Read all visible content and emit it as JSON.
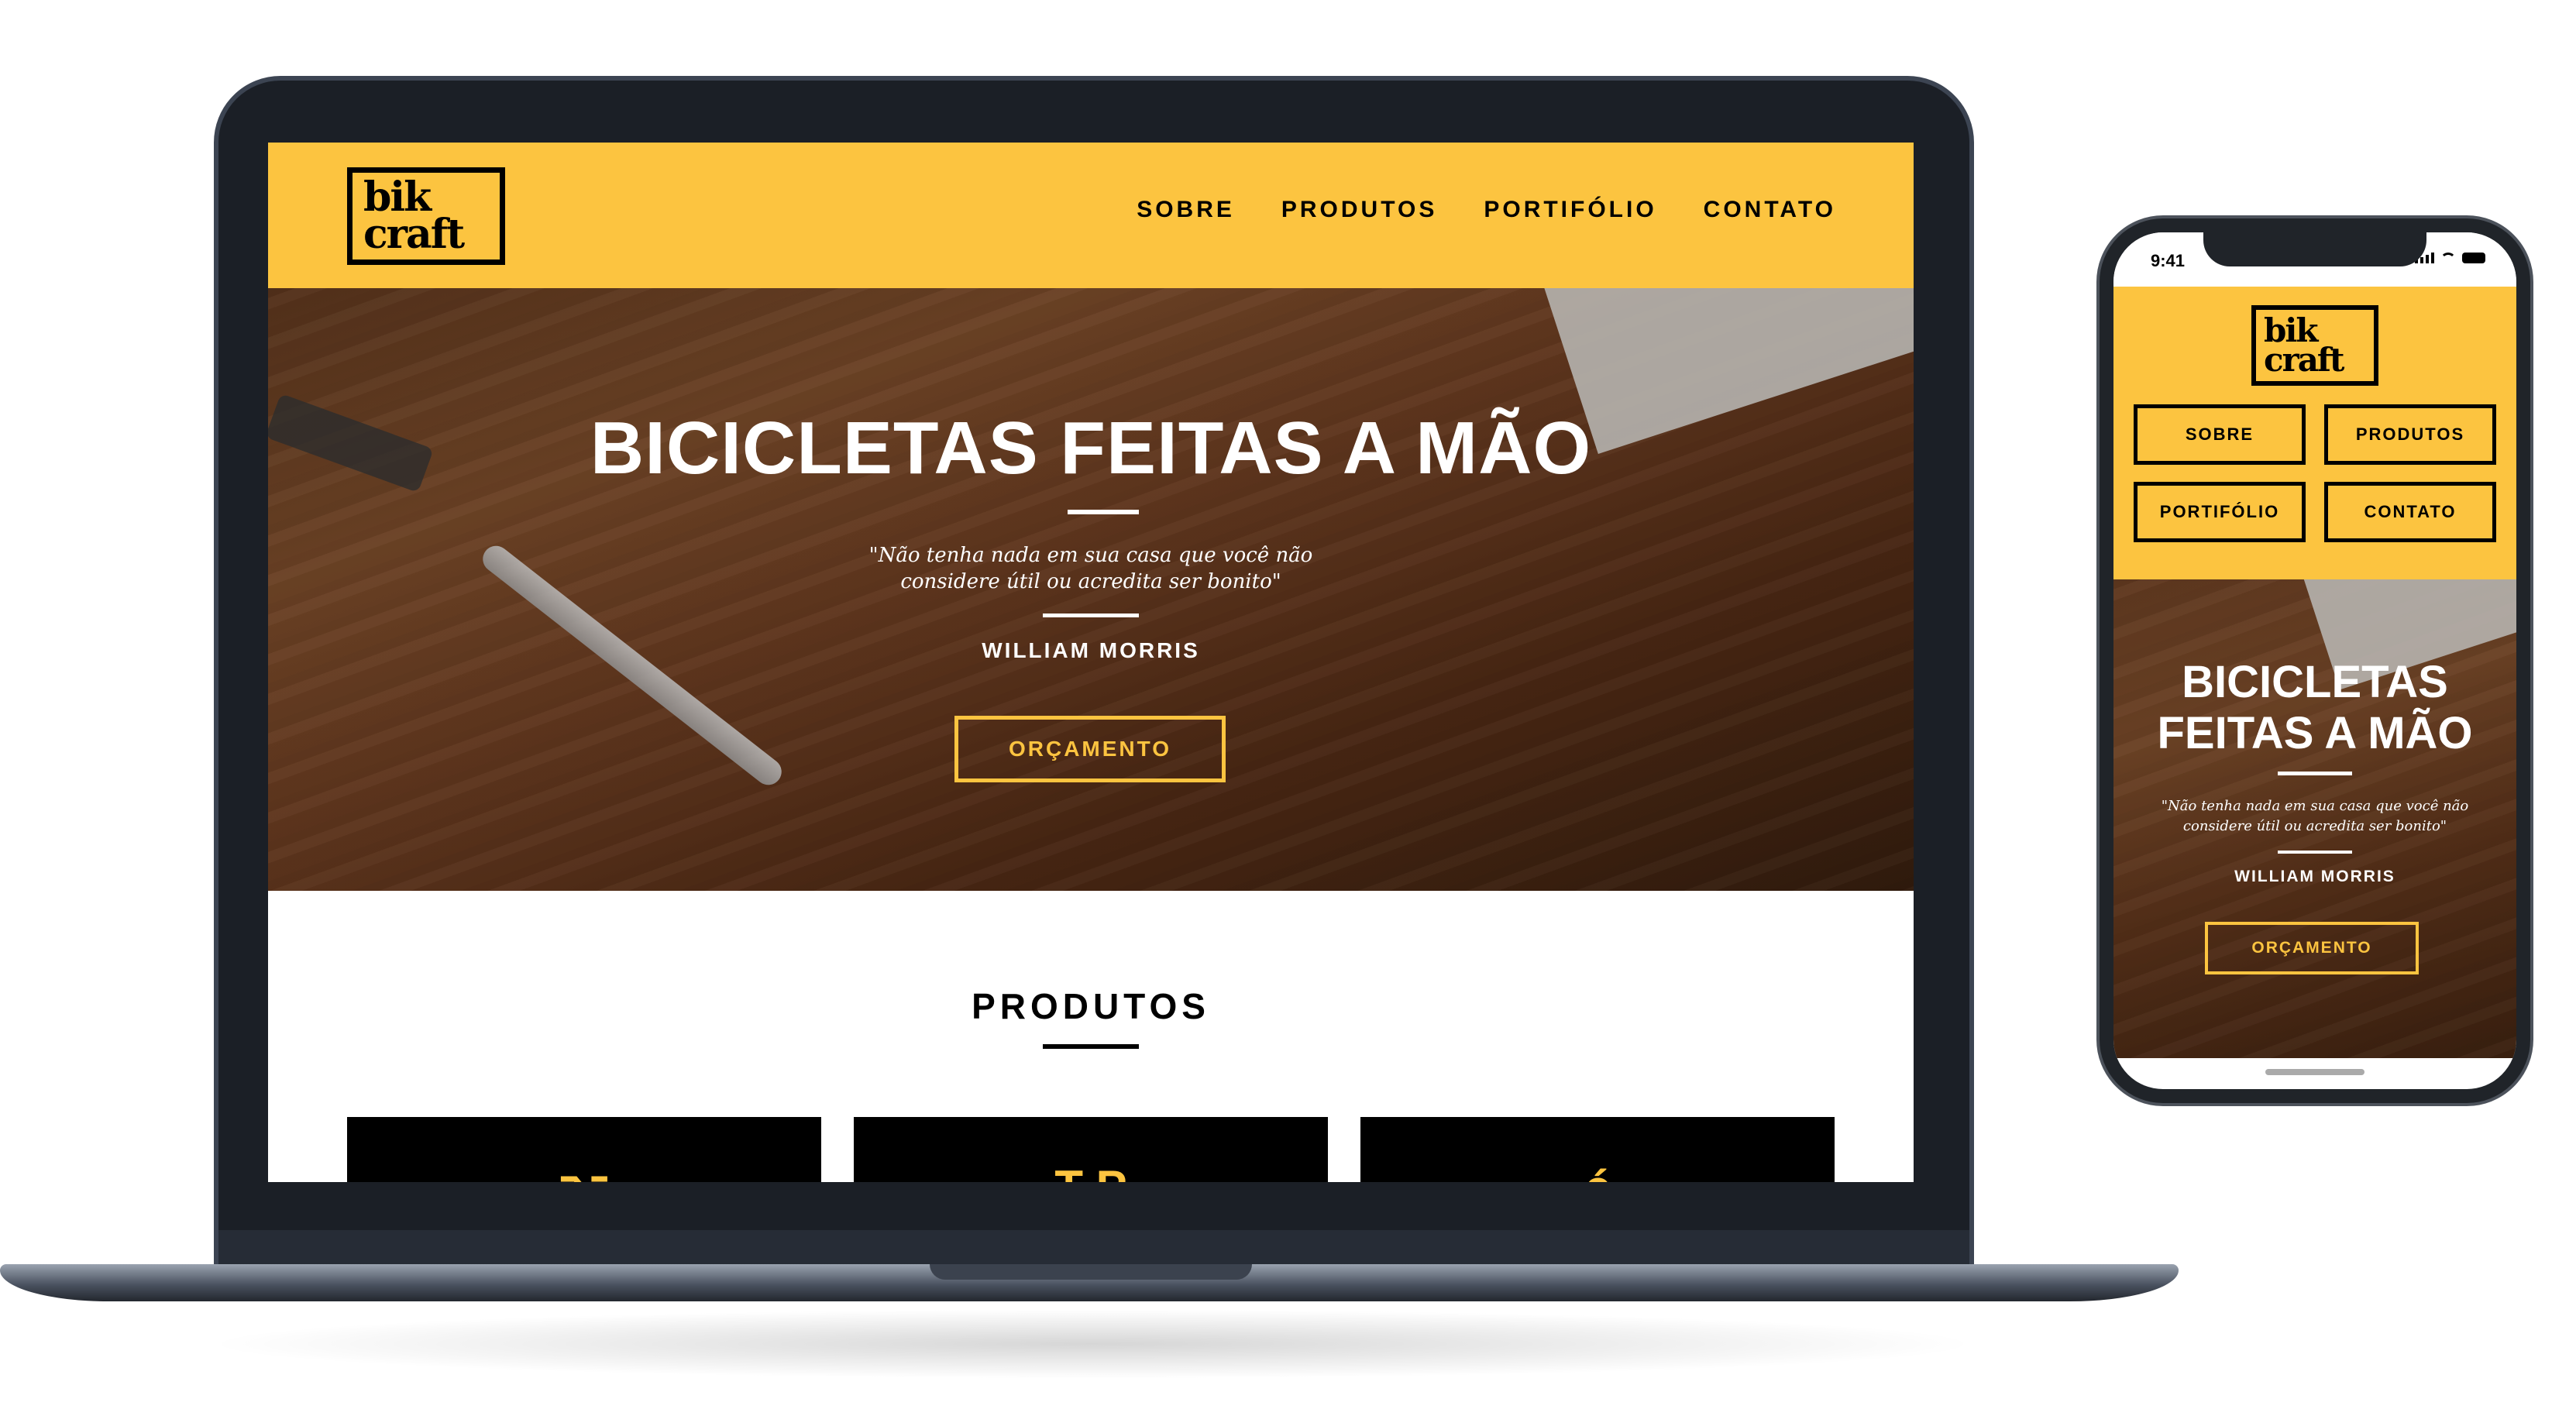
{
  "brand": {
    "logo_line1": "bik",
    "logo_line2": "craft",
    "accent_color": "#fcc440"
  },
  "nav": {
    "items": [
      {
        "label": "SOBRE"
      },
      {
        "label": "PRODUTOS"
      },
      {
        "label": "PORTIFÓLIO"
      },
      {
        "label": "CONTATO"
      }
    ]
  },
  "hero": {
    "title": "BICICLETAS FEITAS A MÃO",
    "title_mobile_line1": "BICICLETAS",
    "title_mobile_line2": "FEITAS A MÃO",
    "quote": "\"Não tenha nada em sua casa que você não considere útil ou acredita ser bonito\"",
    "author": "WILLIAM MORRIS",
    "cta_label": "ORÇAMENTO"
  },
  "products": {
    "title": "PRODUTOS",
    "card_glyphs": [
      "⌥",
      "T P",
      "ć"
    ]
  },
  "phone": {
    "status_time": "9:41"
  },
  "icons": [
    "logo-icon",
    "signal-icon",
    "wifi-icon",
    "battery-icon",
    "home-indicator"
  ]
}
